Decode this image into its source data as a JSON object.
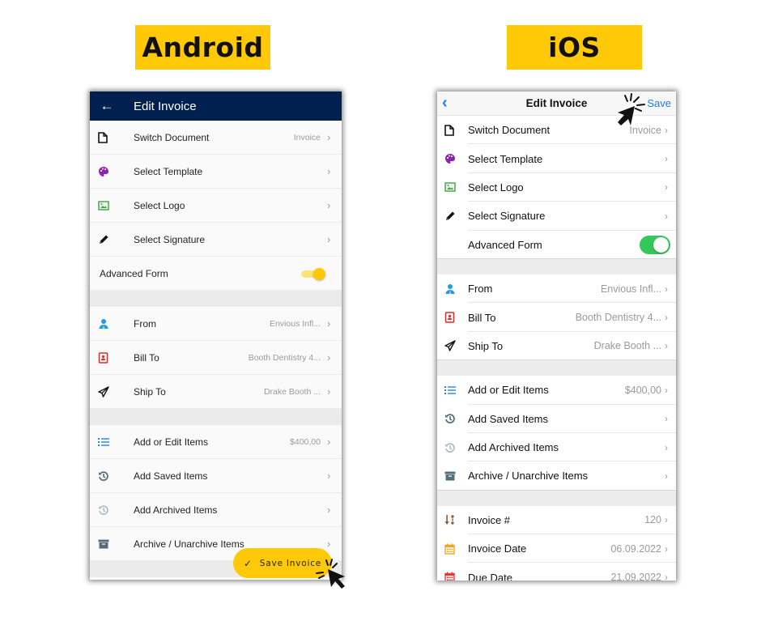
{
  "labels": {
    "android": "Android",
    "ios": "iOS"
  },
  "colors": {
    "android_appbar": "#00204f",
    "accent_yellow": "#ffc907",
    "ios_blue": "#1a7cf5",
    "ios_switch_on": "#34c759"
  },
  "android": {
    "appbar": {
      "back_icon": "arrow-left",
      "title": "Edit Invoice"
    },
    "section1": [
      {
        "icon": "document-icon",
        "label": "Switch Document",
        "value": "Invoice"
      },
      {
        "icon": "palette-icon",
        "label": "Select Template",
        "value": ""
      },
      {
        "icon": "image-icon",
        "label": "Select Logo",
        "value": ""
      },
      {
        "icon": "pencil-icon",
        "label": "Select Signature",
        "value": ""
      }
    ],
    "advanced_form": {
      "label": "Advanced Form",
      "enabled": true
    },
    "section2": [
      {
        "icon": "person-icon",
        "label": "From",
        "value": "Envious Infl..."
      },
      {
        "icon": "contact-book-icon",
        "label": "Bill To",
        "value": "Booth Dentistry 4..."
      },
      {
        "icon": "paper-plane-icon",
        "label": "Ship To",
        "value": "Drake Booth ..."
      }
    ],
    "section3": [
      {
        "icon": "list-icon",
        "label": "Add or Edit Items",
        "value": "$400,00"
      },
      {
        "icon": "history-icon",
        "label": "Add Saved Items",
        "value": ""
      },
      {
        "icon": "history-faded-icon",
        "label": "Add Archived Items",
        "value": ""
      },
      {
        "icon": "archive-box-icon",
        "label": "Archive / Unarchive Items",
        "value": ""
      }
    ],
    "fab": {
      "label": "Save Invoice",
      "icon": "check-icon"
    }
  },
  "ios": {
    "navbar": {
      "back_icon": "chevron-left",
      "title": "Edit Invoice",
      "save": "Save"
    },
    "section1": [
      {
        "icon": "document-icon",
        "label": "Switch Document",
        "value": "Invoice"
      },
      {
        "icon": "palette-icon",
        "label": "Select Template",
        "value": ""
      },
      {
        "icon": "image-icon",
        "label": "Select Logo",
        "value": ""
      },
      {
        "icon": "pencil-icon",
        "label": "Select Signature",
        "value": ""
      }
    ],
    "advanced_form": {
      "label": "Advanced Form",
      "enabled": true
    },
    "section2": [
      {
        "icon": "person-icon",
        "label": "From",
        "value": "Envious Infl..."
      },
      {
        "icon": "contact-book-icon",
        "label": "Bill To",
        "value": "Booth Dentistry 4..."
      },
      {
        "icon": "paper-plane-icon",
        "label": "Ship To",
        "value": "Drake Booth ..."
      }
    ],
    "section3": [
      {
        "icon": "list-icon",
        "label": "Add or Edit Items",
        "value": "$400,00"
      },
      {
        "icon": "history-icon",
        "label": "Add Saved Items",
        "value": ""
      },
      {
        "icon": "history-faded-icon",
        "label": "Add Archived Items",
        "value": ""
      },
      {
        "icon": "archive-box-icon",
        "label": "Archive / Unarchive Items",
        "value": ""
      }
    ],
    "section4": [
      {
        "icon": "sort-number-icon",
        "label": "Invoice #",
        "value": "120"
      },
      {
        "icon": "calendar-orange-icon",
        "label": "Invoice Date",
        "value": "06.09.2022"
      },
      {
        "icon": "calendar-red-icon",
        "label": "Due Date",
        "value": "21.09.2022"
      }
    ]
  }
}
